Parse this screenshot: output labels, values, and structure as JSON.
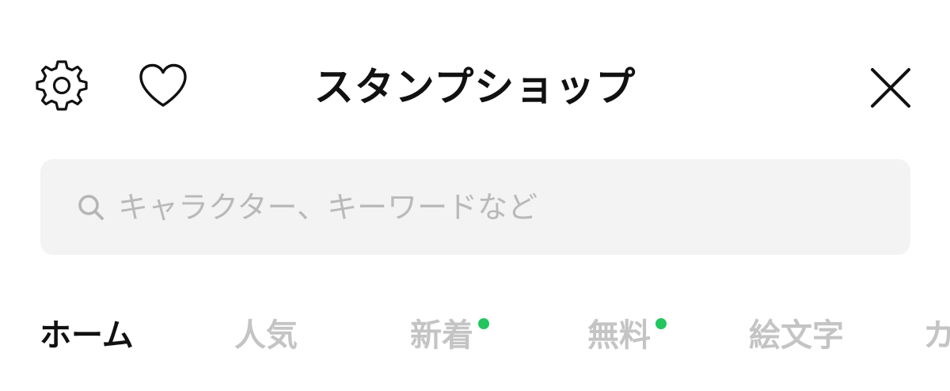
{
  "header": {
    "title": "スタンプショップ",
    "settings_icon": "gear-icon",
    "favorite_icon": "heart-icon",
    "close_icon": "close-icon"
  },
  "search": {
    "placeholder": "キャラクター、キーワードなど",
    "value": "",
    "icon": "search-icon"
  },
  "tabs": [
    {
      "label": "ホーム",
      "active": true,
      "dot": false
    },
    {
      "label": "人気",
      "active": false,
      "dot": false
    },
    {
      "label": "新着",
      "active": false,
      "dot": true
    },
    {
      "label": "無料",
      "active": false,
      "dot": true
    },
    {
      "label": "絵文字",
      "active": false,
      "dot": false
    },
    {
      "label": "カ",
      "active": false,
      "dot": false
    }
  ],
  "colors": {
    "text_primary": "#111111",
    "text_inactive": "#c4c4c4",
    "search_bg": "#f3f3f3",
    "placeholder": "#b9b9b9",
    "dot_green": "#22c55e"
  }
}
